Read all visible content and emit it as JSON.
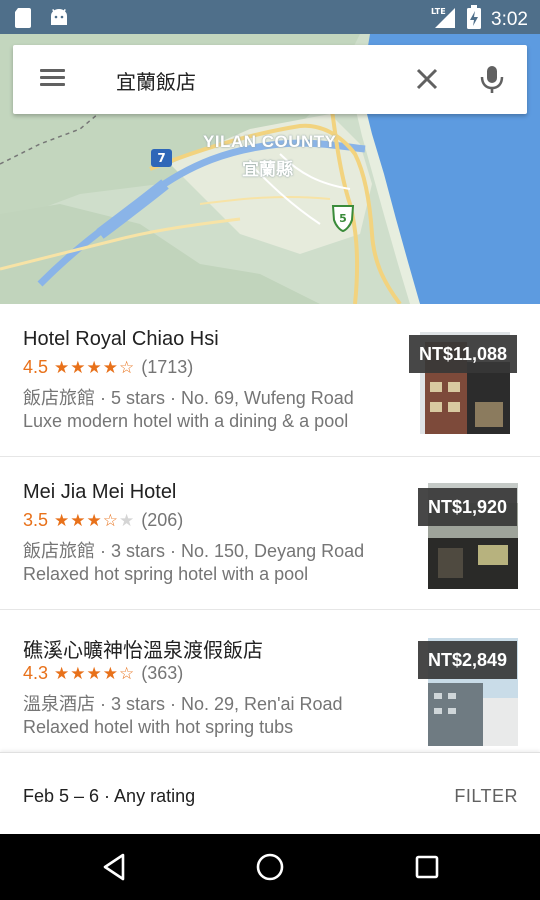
{
  "status_bar": {
    "time": "3:02",
    "network": "LTE",
    "icons": [
      "sd-card-icon",
      "android-icon",
      "signal-icon",
      "battery-charging-icon"
    ]
  },
  "map": {
    "county_label_en": "YILAN COUNTY",
    "county_label_zh": "宜蘭縣",
    "route_markers": [
      "7",
      "5"
    ],
    "colors": {
      "land": "#d3e2cf",
      "sea": "#4a90d9",
      "road": "#f7dd8c"
    }
  },
  "search": {
    "query": "宜蘭飯店",
    "menu_icon": "menu-icon",
    "clear_icon": "close-icon",
    "voice_icon": "microphone-icon"
  },
  "results": [
    {
      "name": "Hotel Royal Chiao Hsi",
      "score": "4.5",
      "stars": 4.5,
      "reviews": "(1713)",
      "meta": "飯店旅館 · 5 stars · No. 69, Wufeng Road",
      "description": "Luxe modern hotel with a dining & a pool",
      "price": "NT$11,088"
    },
    {
      "name": "Mei Jia Mei Hotel",
      "score": "3.5",
      "stars": 3.5,
      "reviews": "(206)",
      "meta": "飯店旅館 · 3 stars · No. 150, Deyang Road",
      "description": "Relaxed hot spring hotel with a pool",
      "price": "NT$1,920"
    },
    {
      "name": "礁溪心曠神怡溫泉渡假飯店",
      "score": "4.3",
      "stars": 4.5,
      "reviews": "(363)",
      "meta": "溫泉酒店 · 3 stars · No. 29, Ren'ai Road",
      "description": "Relaxed hotel with hot spring tubs",
      "price": "NT$2,849"
    }
  ],
  "filter_bar": {
    "summary": "Feb 5 – 6 · Any rating",
    "filter_label": "FILTER"
  },
  "nav_bar": {
    "icons": [
      "back-icon",
      "home-icon",
      "recents-icon"
    ]
  },
  "colors": {
    "accent_star": "#e8711a",
    "status_bar": "#4f6f8a",
    "price_badge": "#373737"
  }
}
